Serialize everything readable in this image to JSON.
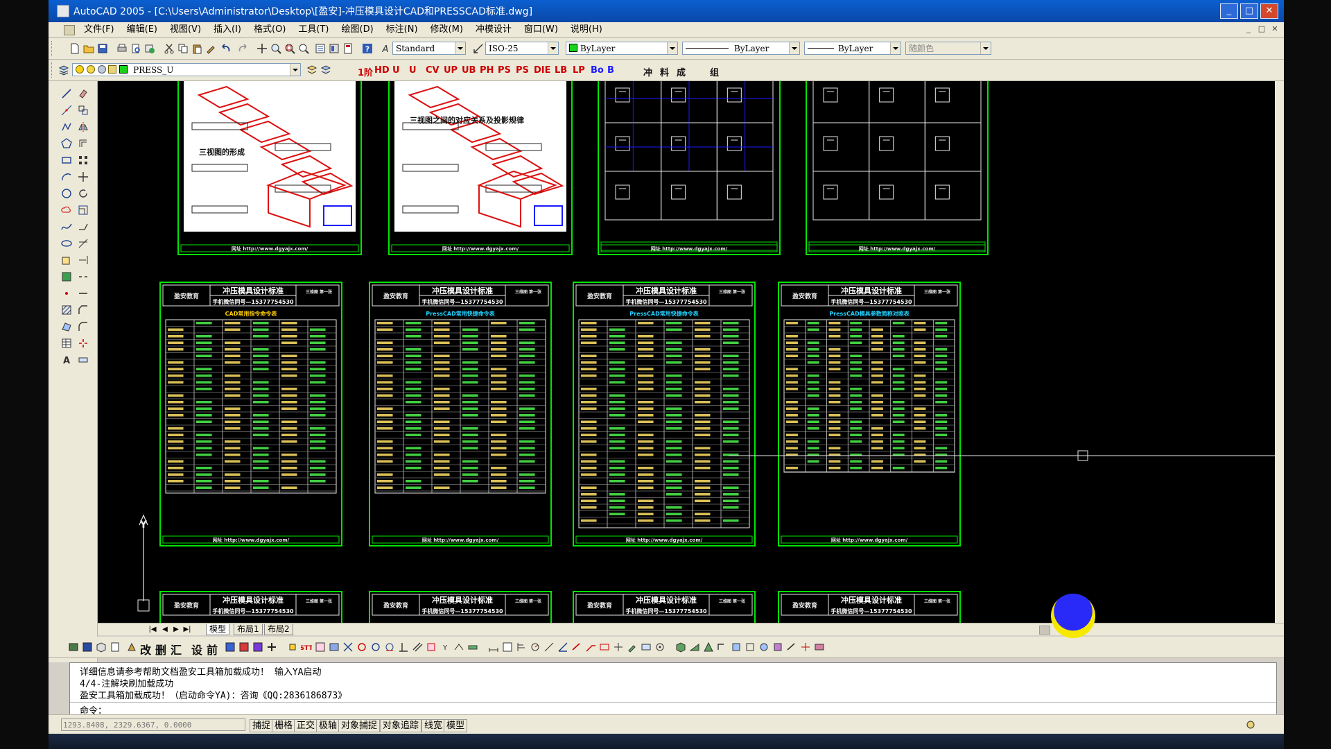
{
  "window": {
    "title": "AutoCAD 2005 - [C:\\Users\\Administrator\\Desktop\\[盈安]-冲压模具设计CAD和PRESSCAD标准.dwg]",
    "minimize_glyph": "_",
    "maximize_glyph": "□",
    "close_glyph": "✕"
  },
  "menu": [
    "文件(F)",
    "编辑(E)",
    "视图(V)",
    "插入(I)",
    "格式(O)",
    "工具(T)",
    "绘图(D)",
    "标注(N)",
    "修改(M)",
    "冲模设计",
    "窗口(W)",
    "说明(H)"
  ],
  "mdi_buttons": [
    "_",
    "□",
    "✕"
  ],
  "toolbar": {
    "text_style": "Standard",
    "dim_style": "ISO-25",
    "layer": "PRESS_U",
    "color": "ByLayer",
    "linetype": "ByLayer",
    "lineweight": "ByLayer",
    "plot_style": "随颜色"
  },
  "press_toolbar": [
    "1阶",
    "HD",
    "U",
    "U",
    "CV",
    "UP",
    "UB",
    "PH",
    "PS",
    "PS",
    "DIE",
    "LB",
    "LP",
    "Bo",
    "B",
    "冲",
    "料",
    "成",
    "组"
  ],
  "cn_toolbar": [
    "改",
    "删",
    "汇",
    "设",
    "前"
  ],
  "layout_tabs": [
    "模型",
    "布局1",
    "布局2"
  ],
  "sheets": {
    "header_left": "盈安教育",
    "header_title": "冲压模具设计标准",
    "header_contact": "手机微信同号—15377754530",
    "header_page": "三维图 第一张",
    "footer_url": "网址 http://www.dgyajx.com/",
    "table_titles": [
      "CAD常用指令命令表",
      "PressCAD常用快捷命令表",
      "PressCAD常用快捷命令表",
      "PressCAD模具参数简称对照表"
    ],
    "drawing_titles": [
      "三视图的形成",
      "三视图之间的对应关系及投影规律"
    ]
  },
  "command_history": [
    "详细信息请参考帮助文档盈安工具箱加载成功！ 输入YA启动",
    "4/4-注解块刷加载成功",
    "盈安工具箱加载成功！（启动命令YA)：咨询《QQ:2836186873》"
  ],
  "command_prompt": "命令：",
  "coordinates": "1293.8408, 2329.6367, 0.0000",
  "status_buttons": [
    "捕捉",
    "栅格",
    "正交",
    "极轴",
    "对象捕捉",
    "对象追踪",
    "线宽",
    "模型"
  ],
  "colors": {
    "model_bg": "#000000",
    "sheet_border": "#00e600",
    "accent_red": "#dd1111",
    "accent_blue": "#1a1aff",
    "title_bar": "#0b55c6"
  }
}
